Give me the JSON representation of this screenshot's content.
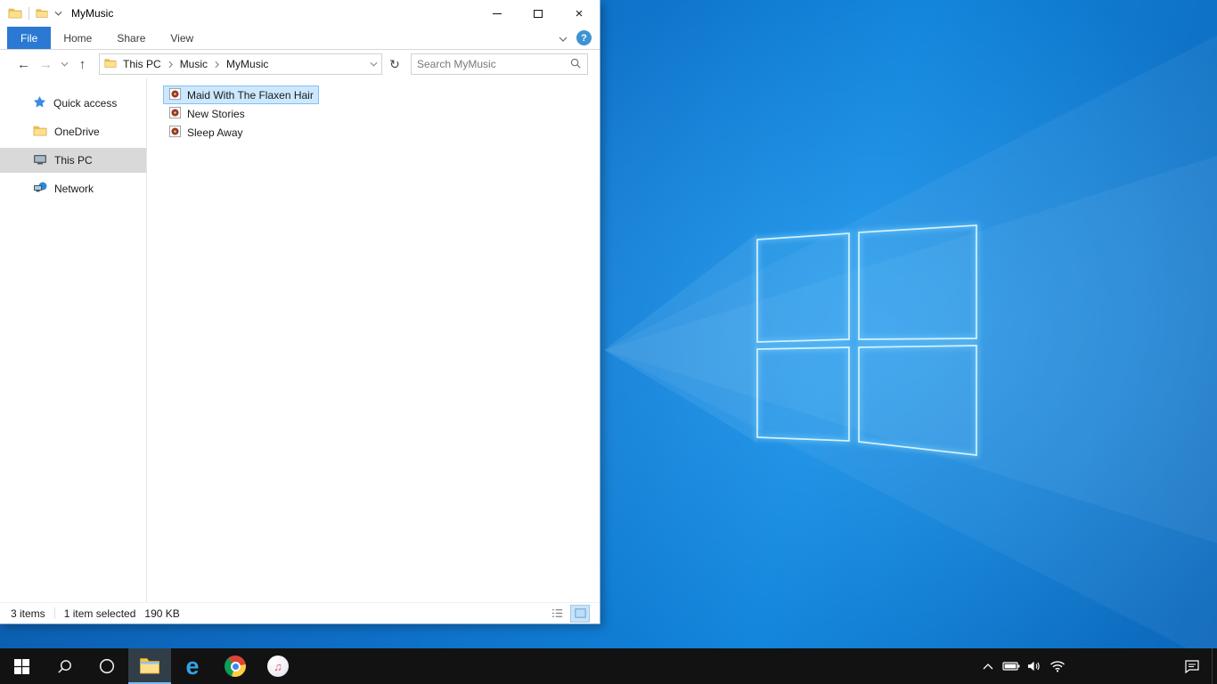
{
  "colors": {
    "accent": "#0078d7",
    "file_tab_blue": "#2b79d2",
    "selection_bg": "#cce8ff",
    "selection_border": "#84bff0",
    "sidebar_selected_bg": "#d9d9d9",
    "taskbar_bg": "#121212",
    "wallpaper_base": "#0e6ec5"
  },
  "explorer": {
    "title": "MyMusic",
    "ribbon": {
      "tabs": [
        {
          "label": "File"
        },
        {
          "label": "Home"
        },
        {
          "label": "Share"
        },
        {
          "label": "View"
        }
      ]
    },
    "address": {
      "breadcrumb": [
        {
          "label": "This PC"
        },
        {
          "label": "Music"
        },
        {
          "label": "MyMusic"
        }
      ]
    },
    "search": {
      "placeholder": "Search MyMusic"
    },
    "sidebar": {
      "items": [
        {
          "label": "Quick access",
          "icon": "star-icon"
        },
        {
          "label": "OneDrive",
          "icon": "folder-icon"
        },
        {
          "label": "This PC",
          "icon": "computer-icon",
          "selected": true
        },
        {
          "label": "Network",
          "icon": "network-icon"
        }
      ]
    },
    "files": [
      {
        "name": "Maid With The Flaxen Hair",
        "icon": "music-file-icon",
        "selected": true
      },
      {
        "name": "New Stories",
        "icon": "music-file-icon",
        "selected": false
      },
      {
        "name": "Sleep Away",
        "icon": "music-file-icon",
        "selected": false
      }
    ],
    "status": {
      "count": "3 items",
      "selected": "1 item selected",
      "size": "190 KB"
    }
  },
  "taskbar": {
    "apps": [
      "start",
      "search",
      "cortana",
      "file-explorer",
      "edge",
      "chrome",
      "itunes"
    ],
    "active_app": "file-explorer",
    "tray": [
      "hidden-icons-chevron",
      "battery",
      "volume",
      "network",
      "action-center",
      "show-desktop"
    ]
  },
  "icons": {
    "back": "←",
    "forward": "→",
    "up": "↑",
    "refresh": "↻",
    "close": "×",
    "help": "?",
    "edge": "e",
    "music_note": "♫"
  }
}
